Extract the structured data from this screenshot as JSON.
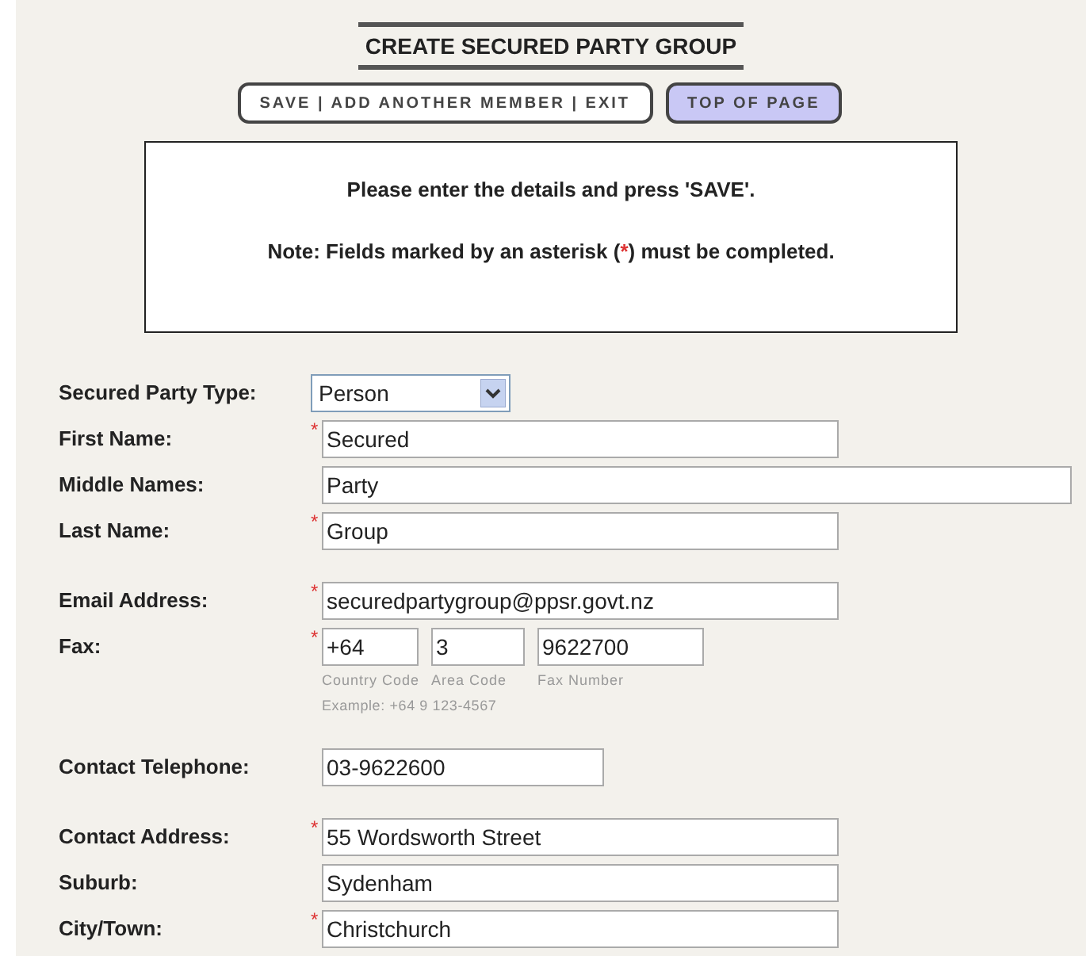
{
  "title": "CREATE SECURED PARTY GROUP",
  "buttons": [
    {
      "label": "SAVE | ADD ANOTHER MEMBER | EXIT",
      "selected": false
    },
    {
      "label": "TOP OF PAGE",
      "selected": true
    }
  ],
  "notice": {
    "line_1": "Please enter the details and press 'SAVE'.",
    "note_before": "Note: Fields marked by an asterisk (",
    "asterisk": "*",
    "note_after": ") must be completed."
  },
  "groups": [
    [
      {
        "kind": "select",
        "label": "Secured Party Type:",
        "required": false,
        "value": "Person"
      },
      {
        "kind": "text",
        "label": "First Name:",
        "required": true,
        "value": "Secured"
      },
      {
        "kind": "wide_text",
        "label": "Middle Names:",
        "required": false,
        "value": "Party"
      },
      {
        "kind": "text",
        "label": "Last Name:",
        "required": true,
        "value": "Group"
      }
    ],
    [
      {
        "kind": "text",
        "label": "Email Address:",
        "required": true,
        "value": "securedpartygroup@ppsr.govt.nz"
      },
      {
        "kind": "fax",
        "label": "Fax:",
        "required": true,
        "parts": [
          {
            "value": "+64",
            "caption": "Country Code"
          },
          {
            "value": "3",
            "caption": "Area Code"
          },
          {
            "value": "9622700",
            "caption": "Fax Number"
          }
        ],
        "example": "Example: +64 9 123-4567"
      }
    ],
    [
      {
        "kind": "short_text",
        "label": "Contact Telephone:",
        "required": false,
        "value": "03-9622600"
      }
    ],
    [
      {
        "kind": "text",
        "label": "Contact Address:",
        "required": true,
        "value": "55 Wordsworth Street"
      },
      {
        "kind": "text",
        "label": "Suburb:",
        "required": false,
        "value": "Sydenham"
      },
      {
        "kind": "text",
        "label": "City/Town:",
        "required": true,
        "value": "Christchurch"
      }
    ]
  ]
}
